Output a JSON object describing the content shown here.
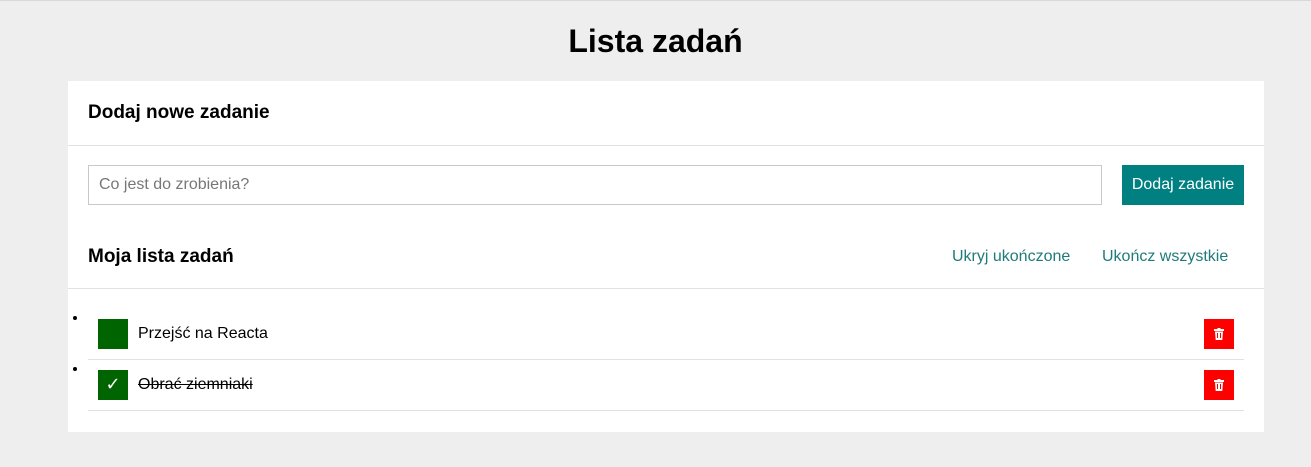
{
  "title": "Lista zadań",
  "add_section": {
    "heading": "Dodaj nowe zadanie",
    "input_placeholder": "Co jest do zrobienia?",
    "input_value": "",
    "add_button_label": "Dodaj zadanie"
  },
  "list_section": {
    "heading": "Moja lista zadań",
    "hide_done_label": "Ukryj ukończone",
    "complete_all_label": "Ukończ wszystkie"
  },
  "tasks": [
    {
      "text": "Przejść na Reacta",
      "done": false,
      "toggle_glyph": ""
    },
    {
      "text": "Obrać ziemniaki",
      "done": true,
      "toggle_glyph": "✓"
    }
  ],
  "icons": {
    "delete": "trash-icon",
    "done": "check-icon"
  },
  "colors": {
    "background": "#eeeeee",
    "accent": "#008080",
    "toggle": "#006400",
    "delete": "#ff0000",
    "link": "#1f7a7a"
  }
}
